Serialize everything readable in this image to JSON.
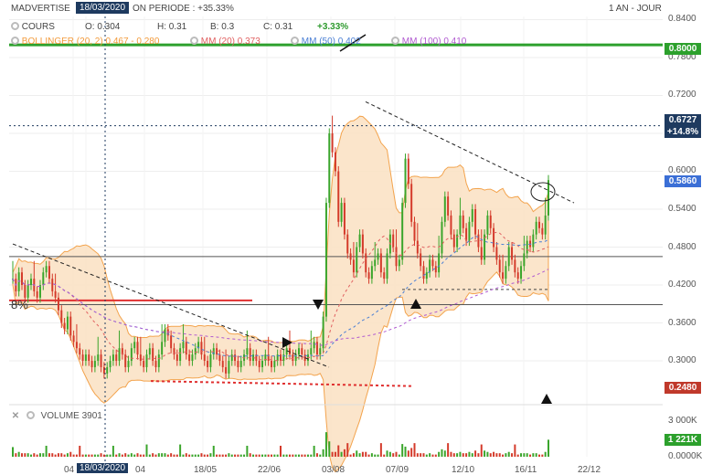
{
  "header": {
    "ticker": "MADVERTISE",
    "cursor_date": "18/03/2020",
    "period_label": "ON PERIODE : +35.33%",
    "timeframe": "1 AN - JOUR",
    "ohlc": {
      "type_label": "COURS",
      "open": "O: 0.304",
      "high": "H: 0.31",
      "low": "B: 0.3",
      "close": "C: 0.31",
      "change": "+3.33%"
    },
    "indicators": {
      "bollinger": "BOLLINGER (20, 2)  0.467 - 0.280",
      "mm20": "MM (20)  0.373",
      "mm50": "MM (50)  0.402",
      "mm100": "MM (100)  0.410"
    },
    "volume_label": "VOLUME  3901",
    "left_label": "8%"
  },
  "price_tags": {
    "resistance": "0.8000",
    "high": "0.6727",
    "high_change": "+14.8%",
    "last": "0.5860",
    "low": "0.2480"
  },
  "volume_axis": {
    "ticks": [
      "3 000K",
      "0.0000K"
    ],
    "last": "1 221K"
  },
  "icons": [
    "gear-icon",
    "settings-icon",
    "close-icon"
  ],
  "colors": {
    "up": "#3aa52b",
    "down": "#d43a2a",
    "bollinger_fill": "#fbe3c6",
    "bollinger_line": "#f29a3a",
    "mm20": "#e06060",
    "mm50": "#4a7fd4",
    "mm100": "#b05ad0",
    "resistance": "#2ca02c",
    "cursor_tag": "#1e3a5f"
  },
  "chart_data": {
    "type": "candlestick",
    "x_tick_labels": [
      "04",
      "18/03/2020",
      "04",
      "18/05",
      "22/06",
      "03/08",
      "07/09",
      "12/10",
      "16/11",
      "22/12"
    ],
    "y_ticks": [
      0.84,
      0.78,
      0.72,
      0.66,
      0.6,
      0.54,
      0.48,
      0.42,
      0.36,
      0.3
    ],
    "ylim": [
      0.235,
      0.845
    ],
    "close_series": [
      0.43,
      0.41,
      0.44,
      0.42,
      0.4,
      0.42,
      0.43,
      0.41,
      0.4,
      0.42,
      0.44,
      0.45,
      0.43,
      0.41,
      0.4,
      0.38,
      0.36,
      0.35,
      0.37,
      0.34,
      0.33,
      0.32,
      0.31,
      0.3,
      0.31,
      0.3,
      0.29,
      0.3,
      0.31,
      0.29,
      0.28,
      0.29,
      0.3,
      0.31,
      0.3,
      0.32,
      0.31,
      0.29,
      0.3,
      0.32,
      0.33,
      0.31,
      0.3,
      0.29,
      0.31,
      0.32,
      0.3,
      0.29,
      0.31,
      0.33,
      0.35,
      0.34,
      0.32,
      0.31,
      0.3,
      0.32,
      0.33,
      0.31,
      0.3,
      0.31,
      0.32,
      0.33,
      0.31,
      0.3,
      0.29,
      0.31,
      0.32,
      0.31,
      0.3,
      0.29,
      0.28,
      0.3,
      0.31,
      0.3,
      0.29,
      0.3,
      0.31,
      0.32,
      0.3,
      0.31,
      0.3,
      0.29,
      0.3,
      0.31,
      0.3,
      0.29,
      0.3,
      0.31,
      0.3,
      0.31,
      0.32,
      0.31,
      0.3,
      0.31,
      0.32,
      0.31,
      0.3,
      0.31,
      0.32,
      0.33,
      0.31,
      0.32,
      0.37,
      0.55,
      0.66,
      0.63,
      0.6,
      0.52,
      0.55,
      0.5,
      0.47,
      0.46,
      0.44,
      0.48,
      0.5,
      0.47,
      0.44,
      0.43,
      0.45,
      0.46,
      0.47,
      0.44,
      0.43,
      0.47,
      0.5,
      0.48,
      0.45,
      0.46,
      0.55,
      0.62,
      0.58,
      0.52,
      0.49,
      0.47,
      0.45,
      0.43,
      0.44,
      0.46,
      0.45,
      0.44,
      0.47,
      0.52,
      0.56,
      0.53,
      0.5,
      0.48,
      0.5,
      0.53,
      0.51,
      0.49,
      0.52,
      0.54,
      0.5,
      0.48,
      0.46,
      0.5,
      0.53,
      0.51,
      0.48,
      0.46,
      0.44,
      0.43,
      0.45,
      0.48,
      0.46,
      0.44,
      0.43,
      0.45,
      0.47,
      0.49,
      0.48,
      0.5,
      0.52,
      0.51,
      0.5,
      0.53,
      0.586
    ],
    "bollinger": {
      "upper_last": 0.467,
      "lower_last": 0.28
    },
    "moving_averages": {
      "mm20": 0.373,
      "mm50": 0.402,
      "mm100": 0.41
    },
    "horizontal_levels": [
      0.8,
      0.672,
      0.465,
      0.389,
      0.413
    ],
    "volume": {
      "max": 3000,
      "last": 1221
    }
  }
}
